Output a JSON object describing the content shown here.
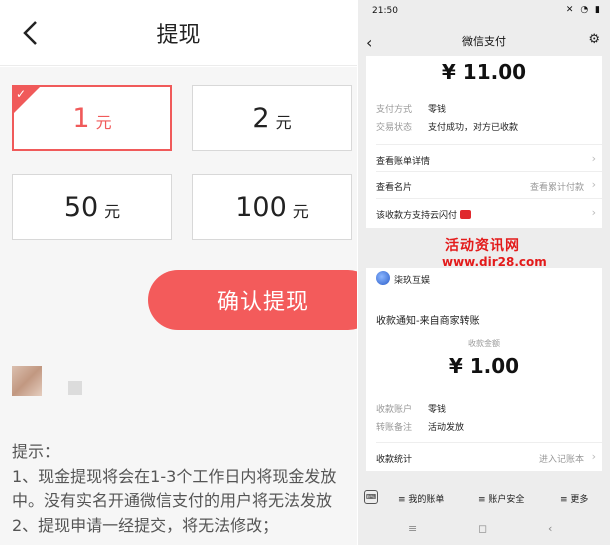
{
  "left": {
    "title": "提现",
    "options": [
      {
        "amount": "1",
        "unit": "元",
        "selected": true
      },
      {
        "amount": "2",
        "unit": "元",
        "selected": false
      },
      {
        "amount": "50",
        "unit": "元",
        "selected": false
      },
      {
        "amount": "100",
        "unit": "元",
        "selected": false
      }
    ],
    "confirm_label": "确认提现",
    "tips": {
      "title": "提示：",
      "line1": "1、现金提现将会在1-3个工作日内将现金发放",
      "line2": "中。没有实名开通微信支付的用户将无法发放",
      "line3": "2、提现申请一经提交，将无法修改；"
    },
    "accent_color": "#f35b5b"
  },
  "right": {
    "status": {
      "time": "21:50",
      "icons": "✕ ◔ ▮"
    },
    "header_title": "微信支付",
    "receipt": {
      "amount": "¥ 11.00",
      "method_label": "支付方式",
      "method_value": "零钱",
      "state_label": "交易状态",
      "state_value": "支付成功，对方已收款",
      "bill_detail": "查看账单详情",
      "card_label": "查看名片",
      "card_value": "查看累计付款",
      "cloud_label": "该收款方支持云闪付"
    },
    "watermark": {
      "line1": "活动资讯网",
      "line2": "www.dir28.com"
    },
    "transfer": {
      "brand": "柒玖互娱",
      "notice": "收款通知-来自商家转账",
      "amount_label": "收款金额",
      "amount": "¥ 1.00",
      "account_label": "收款账户",
      "account_value": "零钱",
      "remark_label": "转账备注",
      "remark_value": "活动发放",
      "stats_label": "收款统计",
      "stats_value": "进入记账本"
    },
    "bottom_menu": [
      "≡ 我的账单",
      "≡ 账户安全",
      "≡ 更多"
    ],
    "nav": [
      "≡",
      "◻",
      "‹"
    ]
  }
}
